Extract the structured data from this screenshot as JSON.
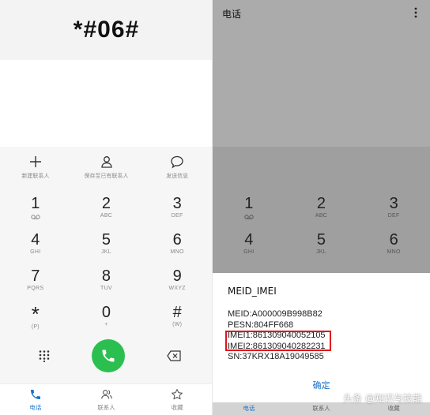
{
  "left": {
    "dialed_code": "*#06#",
    "actions": [
      {
        "label": "新建联系人",
        "icon": "plus-icon"
      },
      {
        "label": "保存至已有联系人",
        "icon": "person-icon"
      },
      {
        "label": "发送信息",
        "icon": "message-icon"
      }
    ],
    "keys": [
      {
        "num": "1",
        "sub": "voicemail-icon"
      },
      {
        "num": "2",
        "sub": "ABC"
      },
      {
        "num": "3",
        "sub": "DEF"
      },
      {
        "num": "4",
        "sub": "GHI"
      },
      {
        "num": "5",
        "sub": "JKL"
      },
      {
        "num": "6",
        "sub": "MNO"
      },
      {
        "num": "7",
        "sub": "PQRS"
      },
      {
        "num": "8",
        "sub": "TUV"
      },
      {
        "num": "9",
        "sub": "WXYZ"
      },
      {
        "num": "*",
        "sub": "(P)"
      },
      {
        "num": "0",
        "sub": "+"
      },
      {
        "num": "#",
        "sub": "(W)"
      }
    ],
    "tabs": [
      {
        "label": "电话",
        "icon": "phone-icon",
        "active": true
      },
      {
        "label": "联系人",
        "icon": "contacts-icon",
        "active": false
      },
      {
        "label": "收藏",
        "icon": "star-icon",
        "active": false
      }
    ]
  },
  "right": {
    "title": "电话",
    "keys": [
      {
        "num": "1",
        "sub": "voicemail-icon"
      },
      {
        "num": "2",
        "sub": "ABC"
      },
      {
        "num": "3",
        "sub": "DEF"
      },
      {
        "num": "4",
        "sub": "GHI"
      },
      {
        "num": "5",
        "sub": "JKL"
      },
      {
        "num": "6",
        "sub": "MNO"
      }
    ],
    "dialog": {
      "title": "MEID_IMEI",
      "lines": [
        "MEID:A000009B998B82",
        "PESN:804FF668",
        "IMEI1:861309040052105",
        "IMEI2:861309040282231",
        "SN:37KRX18A19049585"
      ],
      "ok_label": "确定"
    },
    "tabs": [
      {
        "label": "电话",
        "active": true
      },
      {
        "label": "联系人",
        "active": false
      },
      {
        "label": "收藏",
        "active": false
      }
    ]
  },
  "watermark": "头条 @知识与技能",
  "colors": {
    "call_green": "#2bbf50",
    "accent_blue": "#1a73c9",
    "highlight_red": "#e3121b",
    "overlay_gray": "#ababab"
  }
}
